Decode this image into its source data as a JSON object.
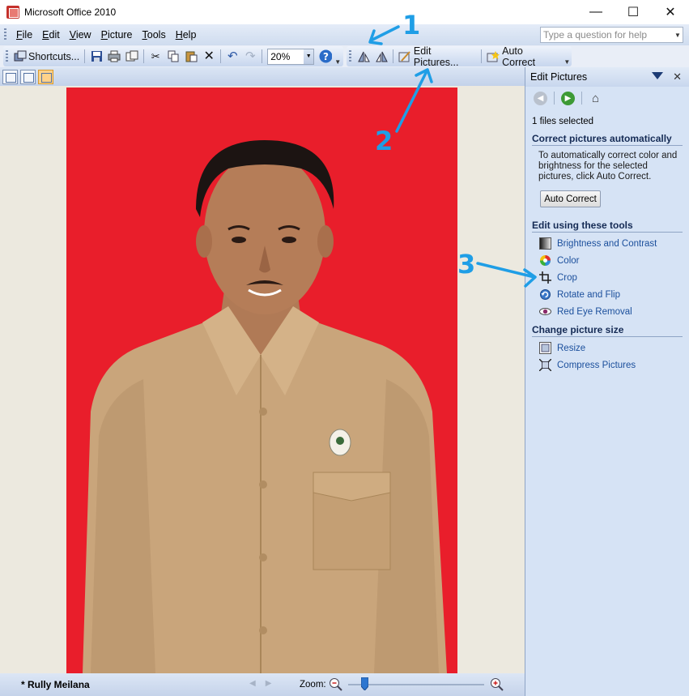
{
  "window": {
    "title": "Microsoft Office 2010",
    "controls": [
      "—",
      "☐",
      "✕"
    ]
  },
  "menubar": {
    "items": [
      {
        "label": "File",
        "key": "F",
        "rest": "ile"
      },
      {
        "label": "Edit",
        "key": "E",
        "rest": "dit"
      },
      {
        "label": "View",
        "key": "V",
        "rest": "iew"
      },
      {
        "label": "Picture",
        "key": "P",
        "rest": "icture"
      },
      {
        "label": "Tools",
        "key": "T",
        "rest": "ools"
      },
      {
        "label": "Help",
        "key": "H",
        "rest": "elp"
      }
    ],
    "help_placeholder": "Type a question for help"
  },
  "toolbar": {
    "shortcuts_label": "Shortcuts...",
    "zoom_value": "20%",
    "edit_pictures_label": "Edit Pictures...",
    "auto_correct_label": "Auto Correct"
  },
  "status": {
    "file_name": "* Rully Meilana",
    "zoom_label": "Zoom:",
    "zoom_level": 0.12
  },
  "taskpane": {
    "title": "Edit Pictures",
    "files_selected": "1 files selected",
    "correct_heading": "Correct pictures automatically",
    "correct_text": "To automatically correct color and brightness for the selected pictures, click Auto Correct.",
    "auto_correct_button": "Auto Correct",
    "tools_heading": "Edit using these tools",
    "tools": [
      "Brightness and Contrast",
      "Color",
      "Crop",
      "Rotate and Flip",
      "Red Eye Removal"
    ],
    "size_heading": "Change picture size",
    "size_tools": [
      "Resize",
      "Compress Pictures"
    ]
  },
  "annotations": [
    "1",
    "2",
    "3"
  ],
  "colors": {
    "accent_blue": "#1f9ee6",
    "photo_background": "#e91e2b",
    "link_blue": "#1b4f9c"
  }
}
